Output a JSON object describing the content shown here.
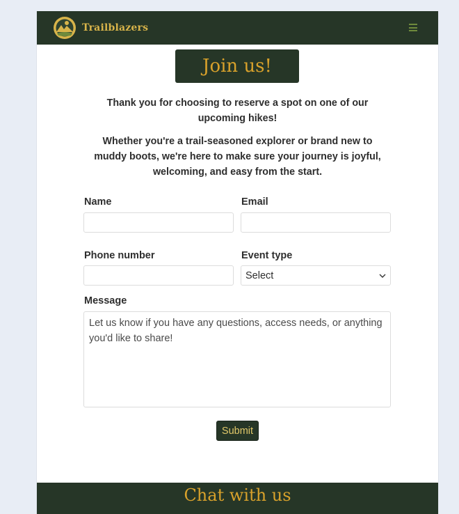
{
  "navbar": {
    "brand": "Trailblazers",
    "logo_icon": "mountain-lake-logo-icon",
    "menu_icon": "hamburger-menu-icon"
  },
  "hero": {
    "title": "Join us!",
    "intro_1": "Thank you for choosing to reserve a spot on one of our upcoming hikes!",
    "intro_2": "Whether you're a trail-seasoned explorer or brand new to muddy boots, we're here to make sure your journey is joyful, welcoming, and easy from the start."
  },
  "form": {
    "name_label": "Name",
    "name_value": "",
    "email_label": "Email",
    "email_value": "",
    "phone_label": "Phone number",
    "phone_value": "",
    "event_label": "Event type",
    "event_selected": "Select",
    "message_label": "Message",
    "message_placeholder": "Let us know if you have any questions, access needs, or anything you'd like to share!",
    "submit_label": "Submit"
  },
  "footer": {
    "heading": "Chat with us"
  },
  "colors": {
    "brand_dark": "#263627",
    "brand_gold": "#d8a12b",
    "page_bg": "#e8edf5"
  }
}
